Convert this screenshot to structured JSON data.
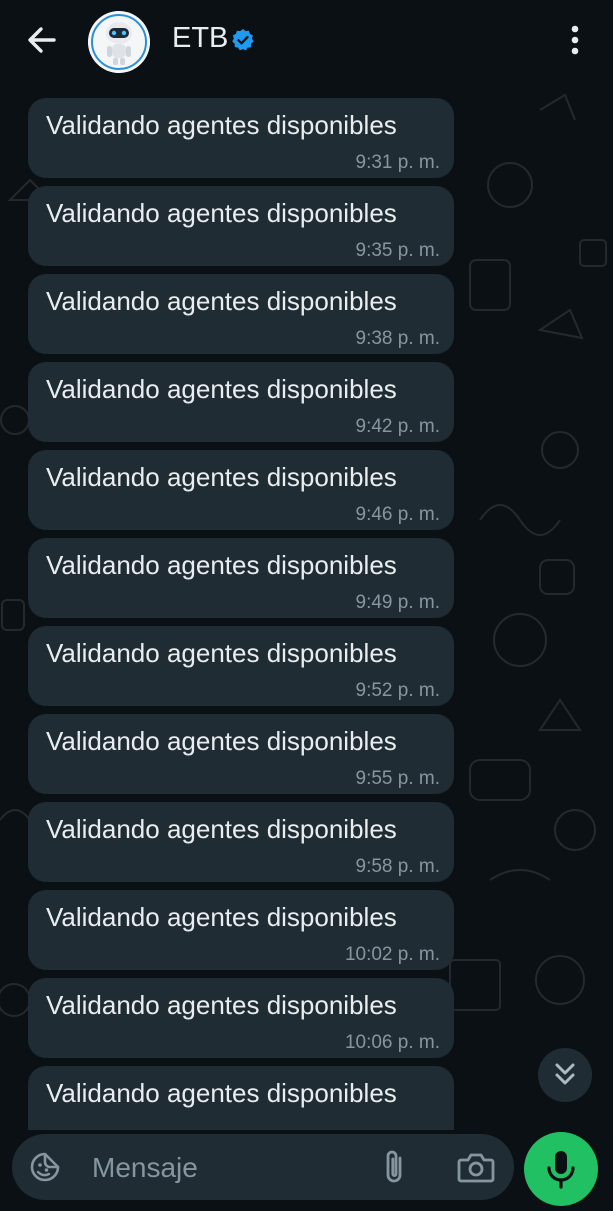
{
  "header": {
    "title": "ETB",
    "verified": true
  },
  "messages": [
    {
      "text": "Validando agentes disponibles",
      "time": "9:31 p. m."
    },
    {
      "text": "Validando agentes disponibles",
      "time": "9:35 p. m."
    },
    {
      "text": "Validando agentes disponibles",
      "time": "9:38 p. m."
    },
    {
      "text": "Validando agentes disponibles",
      "time": "9:42 p. m."
    },
    {
      "text": "Validando agentes disponibles",
      "time": "9:46 p. m."
    },
    {
      "text": "Validando agentes disponibles",
      "time": "9:49 p. m."
    },
    {
      "text": "Validando agentes disponibles",
      "time": "9:52 p. m."
    },
    {
      "text": "Validando agentes disponibles",
      "time": "9:55 p. m."
    },
    {
      "text": "Validando agentes disponibles",
      "time": "9:58 p. m."
    },
    {
      "text": "Validando agentes disponibles",
      "time": "10:02 p. m."
    },
    {
      "text": "Validando agentes disponibles",
      "time": "10:06 p. m."
    },
    {
      "text": "Validando agentes disponibles",
      "time": ""
    }
  ],
  "composer": {
    "placeholder": "Mensaje"
  },
  "icons": {
    "back": "arrow-left-icon",
    "verified": "verified-badge-icon",
    "menu": "more-vertical-icon",
    "scroll": "chevrons-down-icon",
    "emoji": "sticker-icon",
    "attach": "paperclip-icon",
    "camera": "camera-icon",
    "mic": "microphone-icon"
  },
  "colors": {
    "background": "#0b1014",
    "bubble": "#202c33",
    "text": "#e9edef",
    "meta": "#8696a0",
    "accent": "#21c063",
    "verified": "#1d9bf0"
  }
}
